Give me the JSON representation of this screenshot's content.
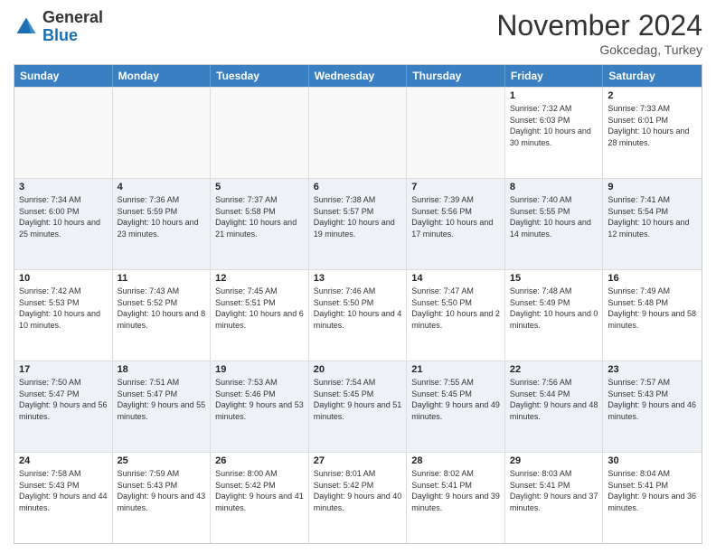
{
  "header": {
    "logo_general": "General",
    "logo_blue": "Blue",
    "month_title": "November 2024",
    "location": "Gokcedag, Turkey"
  },
  "weekdays": [
    "Sunday",
    "Monday",
    "Tuesday",
    "Wednesday",
    "Thursday",
    "Friday",
    "Saturday"
  ],
  "rows": [
    {
      "alt": false,
      "cells": [
        {
          "day": "",
          "info": ""
        },
        {
          "day": "",
          "info": ""
        },
        {
          "day": "",
          "info": ""
        },
        {
          "day": "",
          "info": ""
        },
        {
          "day": "",
          "info": ""
        },
        {
          "day": "1",
          "info": "Sunrise: 7:32 AM\nSunset: 6:03 PM\nDaylight: 10 hours and 30 minutes."
        },
        {
          "day": "2",
          "info": "Sunrise: 7:33 AM\nSunset: 6:01 PM\nDaylight: 10 hours and 28 minutes."
        }
      ]
    },
    {
      "alt": true,
      "cells": [
        {
          "day": "3",
          "info": "Sunrise: 7:34 AM\nSunset: 6:00 PM\nDaylight: 10 hours and 25 minutes."
        },
        {
          "day": "4",
          "info": "Sunrise: 7:36 AM\nSunset: 5:59 PM\nDaylight: 10 hours and 23 minutes."
        },
        {
          "day": "5",
          "info": "Sunrise: 7:37 AM\nSunset: 5:58 PM\nDaylight: 10 hours and 21 minutes."
        },
        {
          "day": "6",
          "info": "Sunrise: 7:38 AM\nSunset: 5:57 PM\nDaylight: 10 hours and 19 minutes."
        },
        {
          "day": "7",
          "info": "Sunrise: 7:39 AM\nSunset: 5:56 PM\nDaylight: 10 hours and 17 minutes."
        },
        {
          "day": "8",
          "info": "Sunrise: 7:40 AM\nSunset: 5:55 PM\nDaylight: 10 hours and 14 minutes."
        },
        {
          "day": "9",
          "info": "Sunrise: 7:41 AM\nSunset: 5:54 PM\nDaylight: 10 hours and 12 minutes."
        }
      ]
    },
    {
      "alt": false,
      "cells": [
        {
          "day": "10",
          "info": "Sunrise: 7:42 AM\nSunset: 5:53 PM\nDaylight: 10 hours and 10 minutes."
        },
        {
          "day": "11",
          "info": "Sunrise: 7:43 AM\nSunset: 5:52 PM\nDaylight: 10 hours and 8 minutes."
        },
        {
          "day": "12",
          "info": "Sunrise: 7:45 AM\nSunset: 5:51 PM\nDaylight: 10 hours and 6 minutes."
        },
        {
          "day": "13",
          "info": "Sunrise: 7:46 AM\nSunset: 5:50 PM\nDaylight: 10 hours and 4 minutes."
        },
        {
          "day": "14",
          "info": "Sunrise: 7:47 AM\nSunset: 5:50 PM\nDaylight: 10 hours and 2 minutes."
        },
        {
          "day": "15",
          "info": "Sunrise: 7:48 AM\nSunset: 5:49 PM\nDaylight: 10 hours and 0 minutes."
        },
        {
          "day": "16",
          "info": "Sunrise: 7:49 AM\nSunset: 5:48 PM\nDaylight: 9 hours and 58 minutes."
        }
      ]
    },
    {
      "alt": true,
      "cells": [
        {
          "day": "17",
          "info": "Sunrise: 7:50 AM\nSunset: 5:47 PM\nDaylight: 9 hours and 56 minutes."
        },
        {
          "day": "18",
          "info": "Sunrise: 7:51 AM\nSunset: 5:47 PM\nDaylight: 9 hours and 55 minutes."
        },
        {
          "day": "19",
          "info": "Sunrise: 7:53 AM\nSunset: 5:46 PM\nDaylight: 9 hours and 53 minutes."
        },
        {
          "day": "20",
          "info": "Sunrise: 7:54 AM\nSunset: 5:45 PM\nDaylight: 9 hours and 51 minutes."
        },
        {
          "day": "21",
          "info": "Sunrise: 7:55 AM\nSunset: 5:45 PM\nDaylight: 9 hours and 49 minutes."
        },
        {
          "day": "22",
          "info": "Sunrise: 7:56 AM\nSunset: 5:44 PM\nDaylight: 9 hours and 48 minutes."
        },
        {
          "day": "23",
          "info": "Sunrise: 7:57 AM\nSunset: 5:43 PM\nDaylight: 9 hours and 46 minutes."
        }
      ]
    },
    {
      "alt": false,
      "cells": [
        {
          "day": "24",
          "info": "Sunrise: 7:58 AM\nSunset: 5:43 PM\nDaylight: 9 hours and 44 minutes."
        },
        {
          "day": "25",
          "info": "Sunrise: 7:59 AM\nSunset: 5:43 PM\nDaylight: 9 hours and 43 minutes."
        },
        {
          "day": "26",
          "info": "Sunrise: 8:00 AM\nSunset: 5:42 PM\nDaylight: 9 hours and 41 minutes."
        },
        {
          "day": "27",
          "info": "Sunrise: 8:01 AM\nSunset: 5:42 PM\nDaylight: 9 hours and 40 minutes."
        },
        {
          "day": "28",
          "info": "Sunrise: 8:02 AM\nSunset: 5:41 PM\nDaylight: 9 hours and 39 minutes."
        },
        {
          "day": "29",
          "info": "Sunrise: 8:03 AM\nSunset: 5:41 PM\nDaylight: 9 hours and 37 minutes."
        },
        {
          "day": "30",
          "info": "Sunrise: 8:04 AM\nSunset: 5:41 PM\nDaylight: 9 hours and 36 minutes."
        }
      ]
    }
  ]
}
